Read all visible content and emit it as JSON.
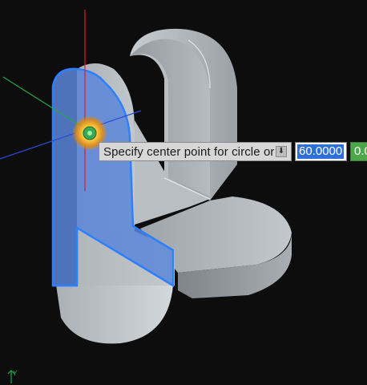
{
  "command_prompt": {
    "text": "Specify center point for circle or",
    "options_icon": "down-arrow-icon"
  },
  "dynamic_input": {
    "first_value": "60.0000",
    "second_value": "0.0"
  },
  "colors": {
    "background": "#0d0d0e",
    "selection_face": "#5b86d8",
    "selection_edge": "#2f7fff",
    "x_axis": "#2b4bd6",
    "y_axis": "#d62020",
    "z_axis": "#21a84b",
    "snap_marker": "#f2a81d"
  }
}
